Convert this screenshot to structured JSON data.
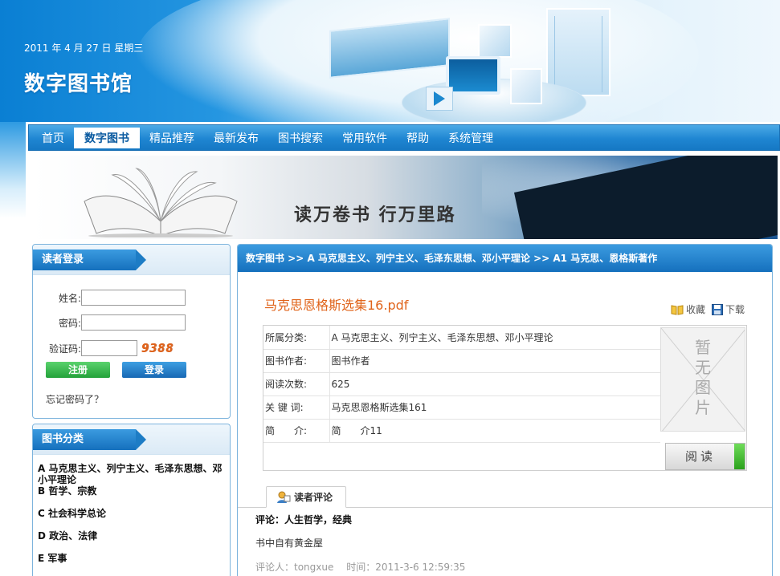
{
  "header": {
    "date": "2011 年 4 月 27 日 星期三",
    "logo": "数字图书馆"
  },
  "nav": {
    "items": [
      "首页",
      "数字图书",
      "精品推荐",
      "最新发布",
      "图书搜索",
      "常用软件",
      "帮助",
      "系统管理"
    ],
    "active_index": 1
  },
  "banner": {
    "slogan": "读万卷书  行万里路"
  },
  "login": {
    "title": "读者登录",
    "name_label": "姓名:",
    "name_value": "",
    "password_label": "密码:",
    "password_value": "",
    "captcha_label": "验证码:",
    "captcha_value": "",
    "captcha_code": "9388",
    "register_label": "注册",
    "login_label": "登录",
    "forgot_label": "忘记密码了？"
  },
  "categories": {
    "title": "图书分类",
    "items": [
      "A 马克思主义、列宁主义、毛泽东思想、邓小平理论",
      "B 哲学、宗教",
      "C 社会科学总论",
      "D 政治、法律",
      "E 军事"
    ]
  },
  "main": {
    "breadcrumb": "数字图书 >> A 马克思主义、列宁主义、毛泽东思想、邓小平理论 >> A1 马克思、恩格斯著作",
    "book_title": "马克思恩格斯选集16.pdf",
    "favorite_label": "收藏",
    "download_label": "下载",
    "info": [
      {
        "key": "所属分类:",
        "value": "A 马克思主义、列宁主义、毛泽东思想、邓小平理论"
      },
      {
        "key": "图书作者:",
        "value": "图书作者"
      },
      {
        "key": "阅读次数:",
        "value": "625"
      },
      {
        "key": "关 键 词:",
        "value": "马克思恩格斯选集161"
      },
      {
        "key": "简　　介:",
        "value": "简　　介11"
      }
    ],
    "no_image_text": "暂无图片",
    "read_label": "阅读",
    "comments_tab": "读者评论",
    "comment": {
      "title": "评论：人生哲学，经典",
      "body": "书中自有黄金屋",
      "author": "评论人：tongxue",
      "time": "时间：2011-3-6 12:59:35"
    }
  },
  "colors": {
    "brand_blue": "#1f86d2",
    "title_orange": "#e0641b",
    "register_green": "#23a23a"
  },
  "icons": {
    "favorite": "book-icon",
    "download": "floppy-disk-icon",
    "comments": "user-comment-icon"
  }
}
